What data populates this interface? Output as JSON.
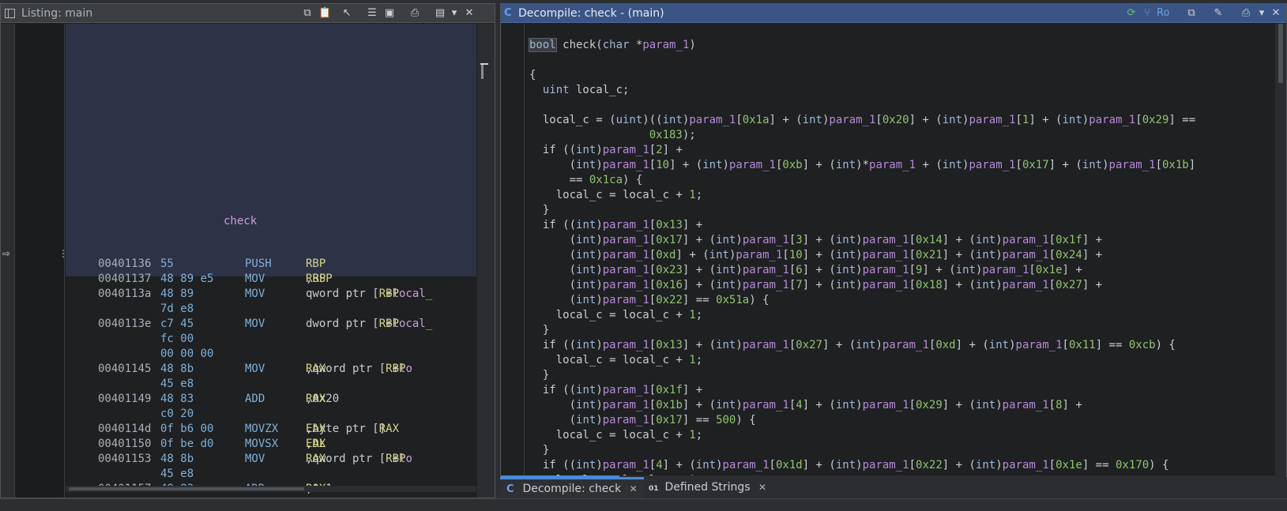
{
  "listing": {
    "title": "Listing:  main",
    "function_label": "check",
    "rows": [
      {
        "addr": "00401136",
        "bytes": "55",
        "mnem": "PUSH",
        "ops": "RBP",
        "sel": true
      },
      {
        "addr": "00401137",
        "bytes": "48 89 e5",
        "mnem": "MOV",
        "ops": "RBP,RSP"
      },
      {
        "addr": "0040113a",
        "bytes": "48 89",
        "mnem": "MOV",
        "ops": "qword ptr [RBP + local_"
      },
      {
        "addr": "",
        "bytes": "7d e8",
        "mnem": "",
        "ops": ""
      },
      {
        "addr": "0040113e",
        "bytes": "c7 45",
        "mnem": "MOV",
        "ops": "dword ptr [RBP + local_"
      },
      {
        "addr": "",
        "bytes": "fc 00",
        "mnem": "",
        "ops": ""
      },
      {
        "addr": "",
        "bytes": "00 00 00",
        "mnem": "",
        "ops": ""
      },
      {
        "addr": "00401145",
        "bytes": "48 8b",
        "mnem": "MOV",
        "ops": "RAX,qword ptr [RBP + lo"
      },
      {
        "addr": "",
        "bytes": "45 e8",
        "mnem": "",
        "ops": ""
      },
      {
        "addr": "00401149",
        "bytes": "48 83",
        "mnem": "ADD",
        "ops": "RAX,0x20"
      },
      {
        "addr": "",
        "bytes": "c0 20",
        "mnem": "",
        "ops": ""
      },
      {
        "addr": "0040114d",
        "bytes": "0f b6 00",
        "mnem": "MOVZX",
        "ops": "EAX,byte ptr [RAX]"
      },
      {
        "addr": "00401150",
        "bytes": "0f be d0",
        "mnem": "MOVSX",
        "ops": "EDX,AL"
      },
      {
        "addr": "00401153",
        "bytes": "48 8b",
        "mnem": "MOV",
        "ops": "RAX,qword ptr [RBP + lo"
      },
      {
        "addr": "",
        "bytes": "45 e8",
        "mnem": "",
        "ops": ""
      },
      {
        "addr": "00401157",
        "bytes": "48 83",
        "mnem": "ADD",
        "ops": "RAX,0x1"
      }
    ]
  },
  "decompile": {
    "title": "Decompile: check -  (main)",
    "toolbar_label": "Ro",
    "lines": [
      {
        "n": "1",
        "t": ""
      },
      {
        "n": "2",
        "t": "bool check(char *param_1)"
      },
      {
        "n": "3",
        "t": ""
      },
      {
        "n": "4",
        "t": "{"
      },
      {
        "n": "5",
        "t": "  uint local_c;"
      },
      {
        "n": "6",
        "t": "  "
      },
      {
        "n": "7",
        "t": "  local_c = (uint)((int)param_1[0x1a] + (int)param_1[0x20] + (int)param_1[1] + (int)param_1[0x29] =="
      },
      {
        "n": "8",
        "t": "                  0x183);"
      },
      {
        "n": "9",
        "t": "  if ((int)param_1[2] +"
      },
      {
        "n": "10",
        "t": "      (int)param_1[10] + (int)param_1[0xb] + (int)*param_1 + (int)param_1[0x17] + (int)param_1[0x1b]"
      },
      {
        "n": "11",
        "t": "      == 0x1ca) {"
      },
      {
        "n": "12",
        "t": "    local_c = local_c + 1;"
      },
      {
        "n": "13",
        "t": "  }"
      },
      {
        "n": "14",
        "t": "  if ((int)param_1[0x13] +"
      },
      {
        "n": "15",
        "t": "      (int)param_1[0x17] + (int)param_1[3] + (int)param_1[0x14] + (int)param_1[0x1f] +"
      },
      {
        "n": "16",
        "t": "      (int)param_1[0xd] + (int)param_1[10] + (int)param_1[0x21] + (int)param_1[0x24] +"
      },
      {
        "n": "17",
        "t": "      (int)param_1[0x23] + (int)param_1[6] + (int)param_1[9] + (int)param_1[0x1e] +"
      },
      {
        "n": "18",
        "t": "      (int)param_1[0x16] + (int)param_1[7] + (int)param_1[0x18] + (int)param_1[0x27] +"
      },
      {
        "n": "19",
        "t": "      (int)param_1[0x22] == 0x51a) {"
      },
      {
        "n": "20",
        "t": "    local_c = local_c + 1;"
      },
      {
        "n": "21",
        "t": "  }"
      },
      {
        "n": "22",
        "t": "  if ((int)param_1[0x13] + (int)param_1[0x27] + (int)param_1[0xd] + (int)param_1[0x11] == 0xcb) {"
      },
      {
        "n": "23",
        "t": "    local_c = local_c + 1;"
      },
      {
        "n": "24",
        "t": "  }"
      },
      {
        "n": "25",
        "t": "  if ((int)param_1[0x1f] +"
      },
      {
        "n": "26",
        "t": "      (int)param_1[0x1b] + (int)param_1[4] + (int)param_1[0x29] + (int)param_1[8] +"
      },
      {
        "n": "27",
        "t": "      (int)param_1[0x17] == 500) {"
      },
      {
        "n": "28",
        "t": "    local_c = local_c + 1;"
      },
      {
        "n": "29",
        "t": "  }"
      },
      {
        "n": "30",
        "t": "  if ((int)param_1[4] + (int)param_1[0x1d] + (int)param_1[0x22] + (int)param_1[0x1e] == 0x170) {"
      },
      {
        "n": "31",
        "t": "    local_c = local_c + 1;"
      }
    ]
  },
  "tabs": [
    {
      "label": "Decompile: check",
      "icon": "C",
      "active": true
    },
    {
      "label": "Defined Strings",
      "icon": "01",
      "active": false
    }
  ],
  "colors": {
    "accent": "#4a8ad8",
    "keyword": "#c9cdd1",
    "param": "#b58ad8",
    "number": "#8fc46e"
  }
}
